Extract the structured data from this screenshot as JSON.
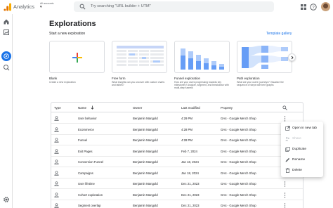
{
  "topbar": {
    "brand": "Analytics",
    "account_label": "All accounts",
    "account_selector": "▾",
    "search_placeholder": "Try searching \"URL builder + UTM\""
  },
  "page": {
    "title": "Explorations",
    "subtitle": "Start a new exploration",
    "gallery_link": "Template gallery"
  },
  "templates": [
    {
      "name": "Blank",
      "description": "Create a new exploration"
    },
    {
      "name": "Free form",
      "description": "What insights can you uncover with custom charts and tables?"
    },
    {
      "name": "Funnel exploration",
      "description": "How are your users progressing towards key milestones? Analyze, segment, and breakdown with multi-step funnels"
    },
    {
      "name": "Path exploration",
      "description": "What are your users' journeys? Visualize the sequence of steps with tree graphs"
    }
  ],
  "table": {
    "headers": {
      "type": "Type",
      "name": "Name",
      "owner": "Owner",
      "last_modified": "Last modified",
      "property": "Property"
    },
    "rows": [
      {
        "name": "User behavior",
        "owner": "Benjamin Mangold",
        "modified": "4:29 PM",
        "property": "GA4 - Google Merch Shop"
      },
      {
        "name": "Ecommerce",
        "owner": "Benjamin Mangold",
        "modified": "4:28 PM",
        "property": "GA4 - Google Merch Shop"
      },
      {
        "name": "Funnel",
        "owner": "Benjamin Mangold",
        "modified": "4:28 PM",
        "property": "GA4 - Google Merch Shop"
      },
      {
        "name": "Exit Pages",
        "owner": "Benjamin Mangold",
        "modified": "Feb 7, 2024",
        "property": "GA4 - Google Merch Shop"
      },
      {
        "name": "Conversion Funnel",
        "owner": "Benjamin Mangold",
        "modified": "Jan 18, 2024",
        "property": "GA4 - Google Merch Shop"
      },
      {
        "name": "Campaigns",
        "owner": "Benjamin Mangold",
        "modified": "Jan 18, 2024",
        "property": "GA4 - Google Merch Shop"
      },
      {
        "name": "User lifetime",
        "owner": "Benjamin Mangold",
        "modified": "Dec 21, 2023",
        "property": "GA4 - Google Merch Shop"
      },
      {
        "name": "Cohort exploration",
        "owner": "Benjamin Mangold",
        "modified": "Dec 21, 2023",
        "property": "GA4 - Google Merch Shop"
      },
      {
        "name": "Segment overlap",
        "owner": "Benjamin Mangold",
        "modified": "Dec 21, 2023",
        "property": "GA4 - Google Merch Shop"
      }
    ]
  },
  "context_menu": {
    "items": [
      {
        "label": "Open in new tab",
        "icon": "open-in-new-icon",
        "enabled": true
      },
      {
        "label": "Share",
        "icon": "share-icon",
        "enabled": false
      },
      {
        "label": "Duplicate",
        "icon": "duplicate-icon",
        "enabled": true
      },
      {
        "label": "Rename",
        "icon": "edit-icon",
        "enabled": true
      },
      {
        "label": "Delete",
        "icon": "trash-icon",
        "enabled": true
      }
    ]
  },
  "colors": {
    "accent": "#1a73e8",
    "logo_orange": "#f9ab00",
    "logo_dark_orange": "#e37400"
  }
}
